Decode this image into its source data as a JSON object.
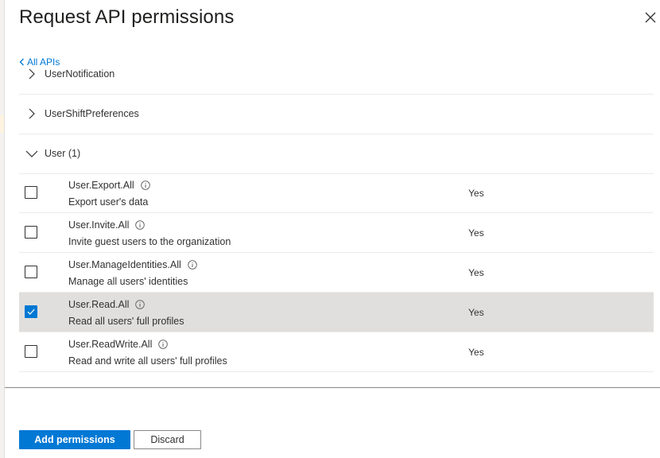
{
  "panel": {
    "title": "Request API permissions",
    "back_link": "All APIs"
  },
  "groups": [
    {
      "label": "UserNotification",
      "expanded": true
    },
    {
      "label": "UserShiftPreferences",
      "expanded": false
    },
    {
      "label": "User (1)",
      "expanded": true
    }
  ],
  "permissions": [
    {
      "name": "User.Export.All",
      "description": "Export user's data",
      "admin_consent": "Yes",
      "checked": false
    },
    {
      "name": "User.Invite.All",
      "description": "Invite guest users to the organization",
      "admin_consent": "Yes",
      "checked": false
    },
    {
      "name": "User.ManageIdentities.All",
      "description": "Manage all users' identities",
      "admin_consent": "Yes",
      "checked": false
    },
    {
      "name": "User.Read.All",
      "description": "Read all users' full profiles",
      "admin_consent": "Yes",
      "checked": true
    },
    {
      "name": "User.ReadWrite.All",
      "description": "Read and write all users' full profiles",
      "admin_consent": "Yes",
      "checked": false
    }
  ],
  "footer": {
    "primary_label": "Add permissions",
    "secondary_label": "Discard"
  },
  "colors": {
    "accent": "#0078d4",
    "selected_row": "#e1dfdd",
    "text": "#323130"
  }
}
